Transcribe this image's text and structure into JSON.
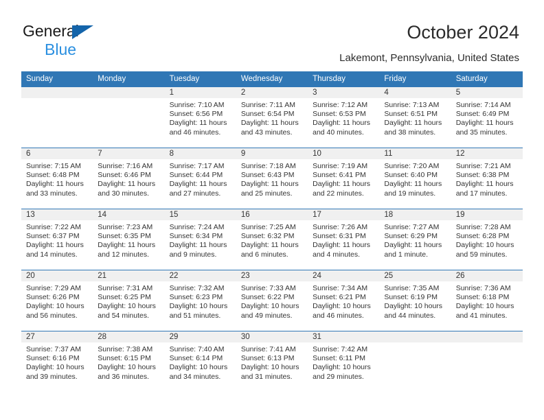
{
  "brand": {
    "line1": "General",
    "line2": "Blue",
    "triangle_color": "#1464aa",
    "line2_color": "#2a8fe0"
  },
  "header": {
    "title": "October 2024",
    "subtitle": "Lakemont, Pennsylvania, United States",
    "header_bg_color": "#3077b5",
    "daynum_bg_color": "#f0f0f0"
  },
  "weekdays": [
    "Sunday",
    "Monday",
    "Tuesday",
    "Wednesday",
    "Thursday",
    "Friday",
    "Saturday"
  ],
  "labels": {
    "sunrise_prefix": "Sunrise:",
    "sunset_prefix": "Sunset:",
    "daylight_prefix": "Daylight:"
  },
  "weeks": [
    [
      {
        "day": "",
        "sunrise": "",
        "sunset": "",
        "daylight_l1": "",
        "daylight_l2": ""
      },
      {
        "day": "",
        "sunrise": "",
        "sunset": "",
        "daylight_l1": "",
        "daylight_l2": ""
      },
      {
        "day": "1",
        "sunrise": "Sunrise: 7:10 AM",
        "sunset": "Sunset: 6:56 PM",
        "daylight_l1": "Daylight: 11 hours",
        "daylight_l2": "and 46 minutes."
      },
      {
        "day": "2",
        "sunrise": "Sunrise: 7:11 AM",
        "sunset": "Sunset: 6:54 PM",
        "daylight_l1": "Daylight: 11 hours",
        "daylight_l2": "and 43 minutes."
      },
      {
        "day": "3",
        "sunrise": "Sunrise: 7:12 AM",
        "sunset": "Sunset: 6:53 PM",
        "daylight_l1": "Daylight: 11 hours",
        "daylight_l2": "and 40 minutes."
      },
      {
        "day": "4",
        "sunrise": "Sunrise: 7:13 AM",
        "sunset": "Sunset: 6:51 PM",
        "daylight_l1": "Daylight: 11 hours",
        "daylight_l2": "and 38 minutes."
      },
      {
        "day": "5",
        "sunrise": "Sunrise: 7:14 AM",
        "sunset": "Sunset: 6:49 PM",
        "daylight_l1": "Daylight: 11 hours",
        "daylight_l2": "and 35 minutes."
      }
    ],
    [
      {
        "day": "6",
        "sunrise": "Sunrise: 7:15 AM",
        "sunset": "Sunset: 6:48 PM",
        "daylight_l1": "Daylight: 11 hours",
        "daylight_l2": "and 33 minutes."
      },
      {
        "day": "7",
        "sunrise": "Sunrise: 7:16 AM",
        "sunset": "Sunset: 6:46 PM",
        "daylight_l1": "Daylight: 11 hours",
        "daylight_l2": "and 30 minutes."
      },
      {
        "day": "8",
        "sunrise": "Sunrise: 7:17 AM",
        "sunset": "Sunset: 6:44 PM",
        "daylight_l1": "Daylight: 11 hours",
        "daylight_l2": "and 27 minutes."
      },
      {
        "day": "9",
        "sunrise": "Sunrise: 7:18 AM",
        "sunset": "Sunset: 6:43 PM",
        "daylight_l1": "Daylight: 11 hours",
        "daylight_l2": "and 25 minutes."
      },
      {
        "day": "10",
        "sunrise": "Sunrise: 7:19 AM",
        "sunset": "Sunset: 6:41 PM",
        "daylight_l1": "Daylight: 11 hours",
        "daylight_l2": "and 22 minutes."
      },
      {
        "day": "11",
        "sunrise": "Sunrise: 7:20 AM",
        "sunset": "Sunset: 6:40 PM",
        "daylight_l1": "Daylight: 11 hours",
        "daylight_l2": "and 19 minutes."
      },
      {
        "day": "12",
        "sunrise": "Sunrise: 7:21 AM",
        "sunset": "Sunset: 6:38 PM",
        "daylight_l1": "Daylight: 11 hours",
        "daylight_l2": "and 17 minutes."
      }
    ],
    [
      {
        "day": "13",
        "sunrise": "Sunrise: 7:22 AM",
        "sunset": "Sunset: 6:37 PM",
        "daylight_l1": "Daylight: 11 hours",
        "daylight_l2": "and 14 minutes."
      },
      {
        "day": "14",
        "sunrise": "Sunrise: 7:23 AM",
        "sunset": "Sunset: 6:35 PM",
        "daylight_l1": "Daylight: 11 hours",
        "daylight_l2": "and 12 minutes."
      },
      {
        "day": "15",
        "sunrise": "Sunrise: 7:24 AM",
        "sunset": "Sunset: 6:34 PM",
        "daylight_l1": "Daylight: 11 hours",
        "daylight_l2": "and 9 minutes."
      },
      {
        "day": "16",
        "sunrise": "Sunrise: 7:25 AM",
        "sunset": "Sunset: 6:32 PM",
        "daylight_l1": "Daylight: 11 hours",
        "daylight_l2": "and 6 minutes."
      },
      {
        "day": "17",
        "sunrise": "Sunrise: 7:26 AM",
        "sunset": "Sunset: 6:31 PM",
        "daylight_l1": "Daylight: 11 hours",
        "daylight_l2": "and 4 minutes."
      },
      {
        "day": "18",
        "sunrise": "Sunrise: 7:27 AM",
        "sunset": "Sunset: 6:29 PM",
        "daylight_l1": "Daylight: 11 hours",
        "daylight_l2": "and 1 minute."
      },
      {
        "day": "19",
        "sunrise": "Sunrise: 7:28 AM",
        "sunset": "Sunset: 6:28 PM",
        "daylight_l1": "Daylight: 10 hours",
        "daylight_l2": "and 59 minutes."
      }
    ],
    [
      {
        "day": "20",
        "sunrise": "Sunrise: 7:29 AM",
        "sunset": "Sunset: 6:26 PM",
        "daylight_l1": "Daylight: 10 hours",
        "daylight_l2": "and 56 minutes."
      },
      {
        "day": "21",
        "sunrise": "Sunrise: 7:31 AM",
        "sunset": "Sunset: 6:25 PM",
        "daylight_l1": "Daylight: 10 hours",
        "daylight_l2": "and 54 minutes."
      },
      {
        "day": "22",
        "sunrise": "Sunrise: 7:32 AM",
        "sunset": "Sunset: 6:23 PM",
        "daylight_l1": "Daylight: 10 hours",
        "daylight_l2": "and 51 minutes."
      },
      {
        "day": "23",
        "sunrise": "Sunrise: 7:33 AM",
        "sunset": "Sunset: 6:22 PM",
        "daylight_l1": "Daylight: 10 hours",
        "daylight_l2": "and 49 minutes."
      },
      {
        "day": "24",
        "sunrise": "Sunrise: 7:34 AM",
        "sunset": "Sunset: 6:21 PM",
        "daylight_l1": "Daylight: 10 hours",
        "daylight_l2": "and 46 minutes."
      },
      {
        "day": "25",
        "sunrise": "Sunrise: 7:35 AM",
        "sunset": "Sunset: 6:19 PM",
        "daylight_l1": "Daylight: 10 hours",
        "daylight_l2": "and 44 minutes."
      },
      {
        "day": "26",
        "sunrise": "Sunrise: 7:36 AM",
        "sunset": "Sunset: 6:18 PM",
        "daylight_l1": "Daylight: 10 hours",
        "daylight_l2": "and 41 minutes."
      }
    ],
    [
      {
        "day": "27",
        "sunrise": "Sunrise: 7:37 AM",
        "sunset": "Sunset: 6:16 PM",
        "daylight_l1": "Daylight: 10 hours",
        "daylight_l2": "and 39 minutes."
      },
      {
        "day": "28",
        "sunrise": "Sunrise: 7:38 AM",
        "sunset": "Sunset: 6:15 PM",
        "daylight_l1": "Daylight: 10 hours",
        "daylight_l2": "and 36 minutes."
      },
      {
        "day": "29",
        "sunrise": "Sunrise: 7:40 AM",
        "sunset": "Sunset: 6:14 PM",
        "daylight_l1": "Daylight: 10 hours",
        "daylight_l2": "and 34 minutes."
      },
      {
        "day": "30",
        "sunrise": "Sunrise: 7:41 AM",
        "sunset": "Sunset: 6:13 PM",
        "daylight_l1": "Daylight: 10 hours",
        "daylight_l2": "and 31 minutes."
      },
      {
        "day": "31",
        "sunrise": "Sunrise: 7:42 AM",
        "sunset": "Sunset: 6:11 PM",
        "daylight_l1": "Daylight: 10 hours",
        "daylight_l2": "and 29 minutes."
      },
      {
        "day": "",
        "sunrise": "",
        "sunset": "",
        "daylight_l1": "",
        "daylight_l2": ""
      },
      {
        "day": "",
        "sunrise": "",
        "sunset": "",
        "daylight_l1": "",
        "daylight_l2": ""
      }
    ]
  ]
}
